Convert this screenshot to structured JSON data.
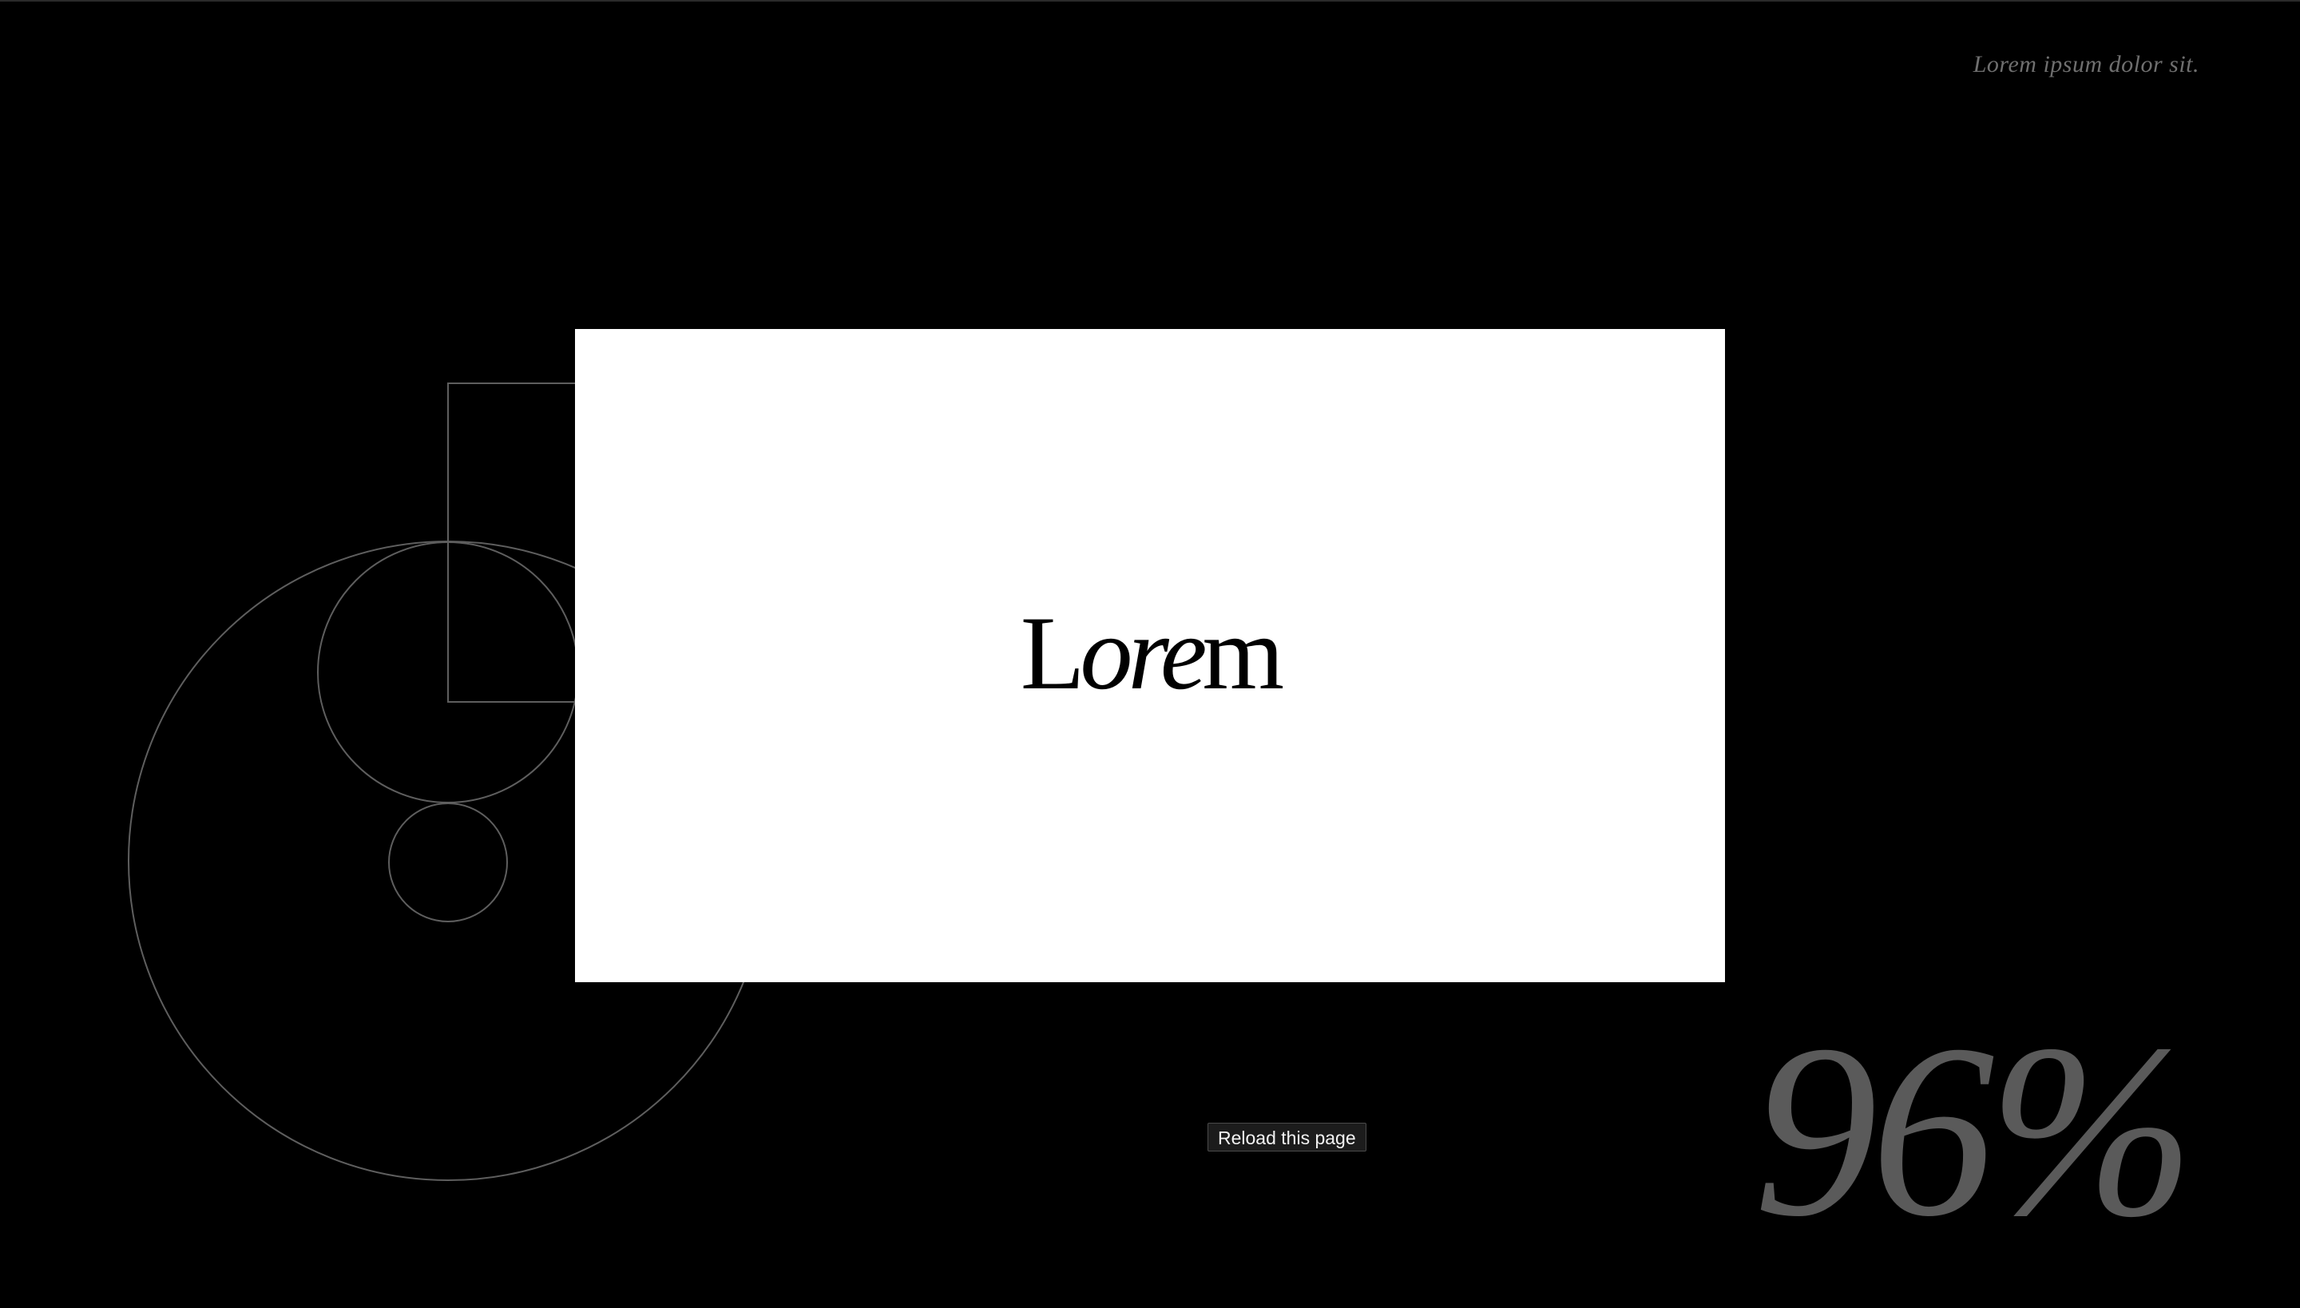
{
  "header": {
    "tagline": "Lorem ipsum dolor sit."
  },
  "card": {
    "logo_plain": "L",
    "logo_italic": "ore",
    "logo_tail": "m"
  },
  "reload": {
    "label": "Reload this page"
  },
  "loader": {
    "progress_label": "96%",
    "progress_value": 96
  },
  "colors": {
    "background": "#000000",
    "card": "#ffffff",
    "line_art": "#5e5e5e",
    "percent_text": "#5a5a5a"
  }
}
